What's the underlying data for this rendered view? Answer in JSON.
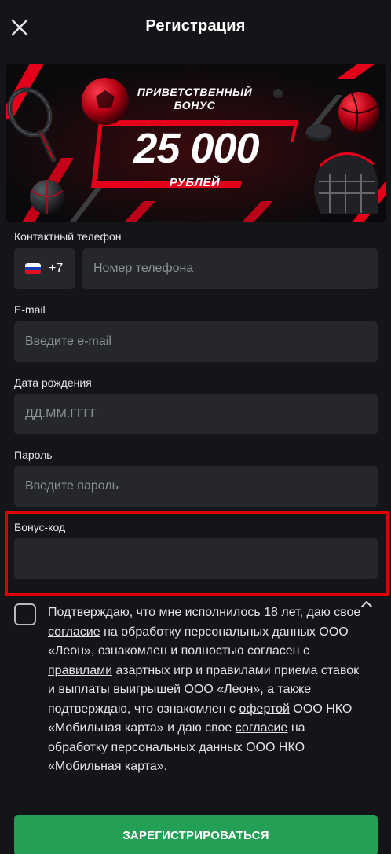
{
  "header": {
    "title": "Регистрация"
  },
  "banner": {
    "title_line1": "ПРИВЕТСТВЕННЫЙ",
    "title_line2": "БОНУС",
    "amount": "25 000",
    "currency": "РУБЛЕЙ"
  },
  "form": {
    "phone": {
      "label": "Контактный телефон",
      "country_code": "+7",
      "placeholder": "Номер телефона"
    },
    "email": {
      "label": "E-mail",
      "placeholder": "Введите e-mail"
    },
    "birthdate": {
      "label": "Дата рождения",
      "placeholder": "ДД.ММ.ГГГГ"
    },
    "password": {
      "label": "Пароль",
      "placeholder": "Введите пароль"
    },
    "bonus_code": {
      "label": "Бонус-код",
      "value": ""
    }
  },
  "consent": {
    "part1": "Подтверждаю, что мне исполнилось 18 лет, даю свое ",
    "link1": "согласие",
    "part2": " на обработку персональных данных ООО «Леон», ознакомлен и полностью согласен с ",
    "link2": "правилами",
    "part3": " азартных игр и правилами приема ставок и выплаты выигрышей ООО «Леон», а также подтверждаю, что ознакомлен с ",
    "link3": "офертой",
    "part4": " ООО НКО «Мобильная карта» и даю свое ",
    "link4": "согласие",
    "part5": " на обработку персональных данных ООО НКО «Мобильная карта»."
  },
  "submit_label": "ЗАРЕГИСТРИРОВАТЬСЯ",
  "colors": {
    "background": "#141518",
    "field": "#25272b",
    "accent_green": "#23a055",
    "highlight_red": "#e00000",
    "banner_red": "#e4001b"
  },
  "icons": {
    "close": "close-icon",
    "flag": "russia-flag-icon",
    "chevron": "chevron-up-icon"
  }
}
